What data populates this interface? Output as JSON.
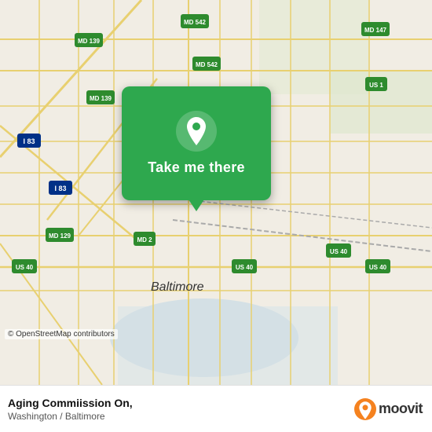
{
  "map": {
    "attribution": "© OpenStreetMap contributors",
    "center": "Baltimore, MD",
    "background_color": "#f2efe9"
  },
  "popup": {
    "button_label": "Take me there",
    "icon": "location-pin-icon"
  },
  "bottom_bar": {
    "location_name": "Aging Commiission On,",
    "location_region": "Washington / Baltimore",
    "moovit_label": "moovit"
  }
}
